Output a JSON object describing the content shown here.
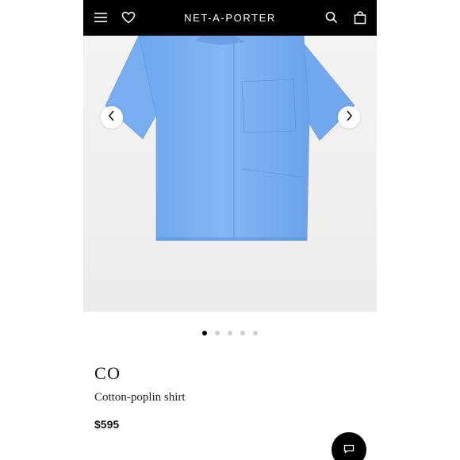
{
  "header": {
    "logo": "NET-A-PORTER",
    "icons": [
      "menu-icon",
      "heart-icon",
      "search-icon",
      "shopping-bag-icon"
    ]
  },
  "gallery": {
    "image": "blue-cotton-poplin-shirt",
    "image_count": 5,
    "active_index": 1,
    "shirt_color": "#7FB2F2"
  },
  "product": {
    "brand": "CO",
    "name": "Cotton-poplin shirt",
    "price": "$595"
  },
  "colors": {
    "header_bg": "#000000",
    "accent": "#000000"
  }
}
